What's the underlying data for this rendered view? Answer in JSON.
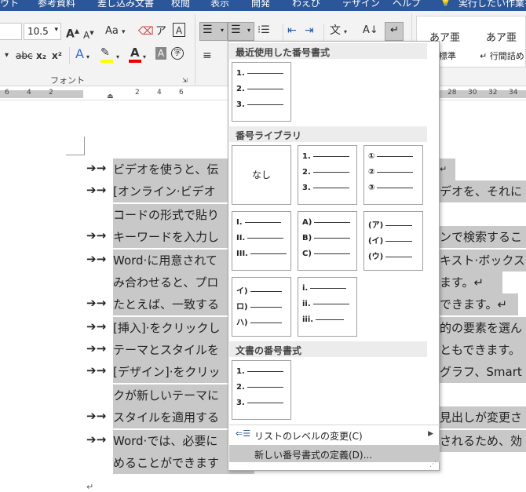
{
  "menubar": {
    "tabs": [
      "ウト",
      "参考資料",
      "差し込み文書",
      "校閲",
      "表示",
      "開発",
      "わえぴ",
      "デザイン",
      "ヘルプ",
      "実行したい作業を"
    ]
  },
  "ribbon": {
    "font_size": "10.5",
    "grow_font": "A",
    "shrink_font": "A",
    "change_case": "Aa",
    "strikethrough": "abc",
    "subscript": "x₂",
    "superscript": "x²",
    "text_effects": "A",
    "font_color": "A",
    "char_shading": "A",
    "enclose_char": "字",
    "font_group_label": "フォント",
    "style1_sample": "あア亜",
    "style1_name": "標準",
    "style2_sample": "あア亜",
    "style2_name": "↵ 行間詰め"
  },
  "ruler": {
    "numbers": [
      "6",
      "4",
      "2",
      "",
      "2",
      "4",
      "6",
      "28",
      "30",
      "32",
      "34",
      "36",
      "38"
    ]
  },
  "document": {
    "lines": [
      {
        "text": "ビデオを使うと、伝"
      },
      {
        "text": "[オンライン·ビデオ"
      },
      {
        "text": "キーワードを入力し"
      },
      {
        "text": "Word·に用意されて"
      },
      {
        "text": "たとえば、一致する"
      },
      {
        "text": "[挿入]·をクリックし"
      },
      {
        "text": "テーマとスタイルを"
      },
      {
        "text": "[デザイン]·をクリッ"
      },
      {
        "text": "スタイルを適用する"
      },
      {
        "text": "Word·では、必要に"
      }
    ],
    "continuation": [
      {
        "text": "コードの形式で貼り"
      },
      {
        "text": "み合わせると、プロ"
      },
      {
        "text": "クが新しいテーマに"
      },
      {
        "text": "めることができます"
      }
    ],
    "right_fragments": [
      "↵",
      "デオを、それに",
      "ンで検索するこ",
      "キスト·ボックス",
      "ます。↵",
      "できます。↵",
      "的の要素を選ん",
      "ともできます。",
      "グラフ、Smart",
      "見出しが変更さ",
      "されるため、効"
    ],
    "end_mark": "↵"
  },
  "dropdown": {
    "recent_header": "最近使用した番号書式",
    "library_header": "番号ライブラリ",
    "document_header": "文書の番号書式",
    "none_label": "なし",
    "recent_tile": [
      "1.",
      "2.",
      "3."
    ],
    "library_tiles": [
      [
        "1.",
        "2.",
        "3."
      ],
      [
        "①",
        "②",
        "③"
      ],
      [
        "I.",
        "II.",
        "III."
      ],
      [
        "A)",
        "B)",
        "C)"
      ],
      [
        "(ア)",
        "(イ)",
        "(ウ)"
      ],
      [
        "イ)",
        "ロ)",
        "ハ)"
      ],
      [
        "i.",
        "ii.",
        "iii."
      ]
    ],
    "document_tile": [
      "1.",
      "2.",
      "3."
    ],
    "menu_items": [
      {
        "label": "リストのレベルの変更(C)"
      },
      {
        "label": "新しい番号書式の定義(D)..."
      }
    ]
  }
}
